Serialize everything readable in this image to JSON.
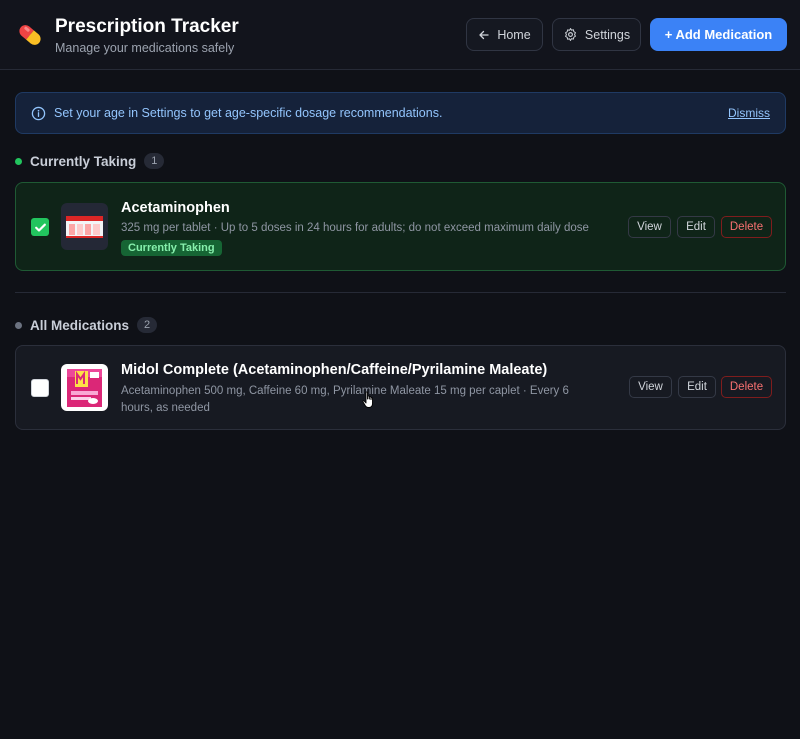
{
  "header": {
    "title": "Prescription Tracker",
    "subtitle": "Manage your medications safely",
    "home_label": "Home",
    "settings_label": "Settings",
    "add_label": "+ Add Medication"
  },
  "banner": {
    "text": "Set your age in Settings to get age-specific dosage recommendations.",
    "dismiss_label": "Dismiss"
  },
  "current_section": {
    "title": "Currently Taking",
    "count": "1",
    "dot_color": "#22c55e",
    "items": [
      {
        "name": "Acetaminophen",
        "description": "325 mg per tablet · Up to 5 doses in 24 hours for adults; do not exceed maximum daily dose",
        "badge": "Currently Taking",
        "checked": true,
        "view_label": "View",
        "edit_label": "Edit",
        "delete_label": "Delete"
      }
    ]
  },
  "all_section": {
    "title": "All Medications",
    "count": "2",
    "dot_color": "#6b7280",
    "items": [
      {
        "name": "Midol Complete (Acetaminophen/Caffeine/Pyrilamine Maleate)",
        "description_line1": "Acetaminophen 500 mg, Caffeine 60 mg, Pyrilamine Maleate 15 mg per caplet · Every 6",
        "description_line2": "hours, as needed",
        "checked": false,
        "view_label": "View",
        "edit_label": "Edit",
        "delete_label": "Delete"
      }
    ]
  },
  "colors": {
    "accent": "#3b82f6",
    "success": "#22c55e",
    "danger": "#f87171",
    "background": "#0f1117"
  },
  "icons": {
    "logo": "pill-icon",
    "home": "arrow-left-icon",
    "settings": "gear-icon",
    "banner": "info-icon",
    "check": "check-icon"
  }
}
